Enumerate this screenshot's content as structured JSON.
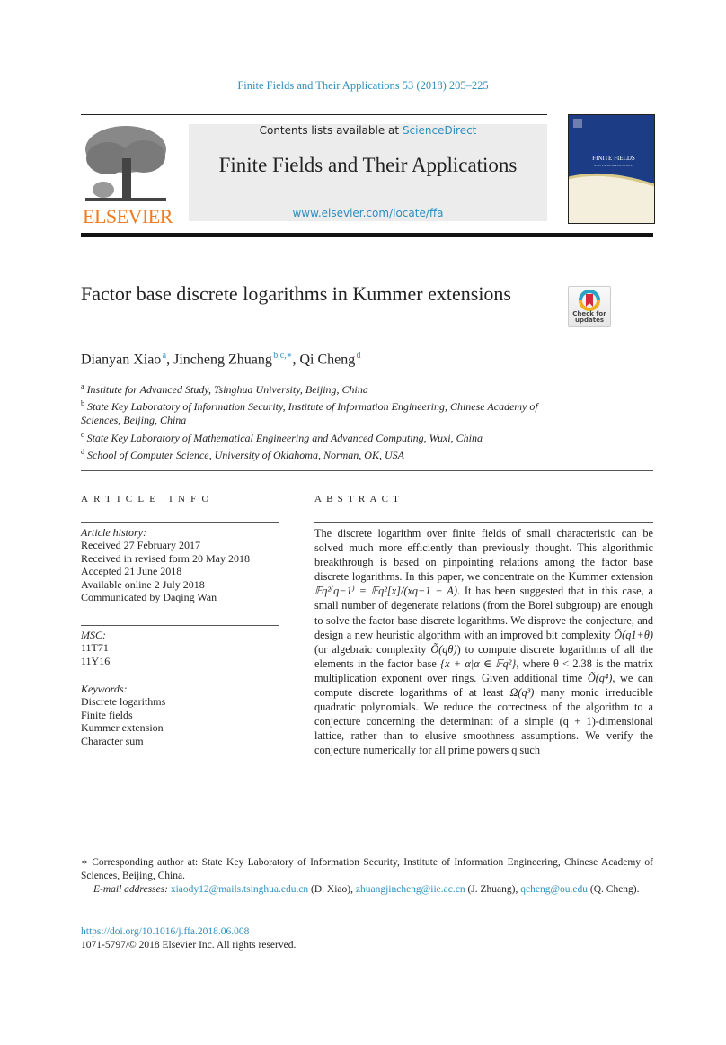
{
  "header": {
    "journal_reference": "Finite Fields and Their Applications 53 (2018) 205–225",
    "contents_prefix": "Contents lists available at ",
    "contents_link": "ScienceDirect",
    "journal_title": "Finite Fields and Their Applications",
    "journal_url": "www.elsevier.com/locate/ffa",
    "publisher_logo_text": "ELSEVIER",
    "cover_title": "FINITE FIELDS",
    "cover_subtitle": "AND THEIR APPLICATIONS"
  },
  "article": {
    "title": "Factor base discrete logarithms in Kummer extensions",
    "crossmark_label": "Check for updates",
    "authors": [
      {
        "name": "Dianyan Xiao",
        "marks": "a"
      },
      {
        "name": "Jincheng Zhuang",
        "marks": "b,c,∗"
      },
      {
        "name": "Qi Cheng",
        "marks": "d"
      }
    ],
    "affiliations": [
      {
        "mark": "a",
        "text": "Institute for Advanced Study, Tsinghua University, Beijing, China"
      },
      {
        "mark": "b",
        "text": "State Key Laboratory of Information Security, Institute of Information Engineering, Chinese Academy of Sciences, Beijing, China"
      },
      {
        "mark": "c",
        "text": "State Key Laboratory of Mathematical Engineering and Advanced Computing, Wuxi, China"
      },
      {
        "mark": "d",
        "text": "School of Computer Science, University of Oklahoma, Norman, OK, USA"
      }
    ]
  },
  "article_info": {
    "heading": "ARTICLE INFO",
    "history_label": "Article history:",
    "history": [
      "Received 27 February 2017",
      "Received in revised form 20 May 2018",
      "Accepted 21 June 2018",
      "Available online 2 July 2018",
      "Communicated by Daqing Wan"
    ],
    "msc_label": "MSC:",
    "msc": [
      "11T71",
      "11Y16"
    ],
    "keywords_label": "Keywords:",
    "keywords": [
      "Discrete logarithms",
      "Finite fields",
      "Kummer extension",
      "Character sum"
    ]
  },
  "abstract": {
    "heading": "ABSTRACT",
    "p1": "The discrete logarithm over finite fields of small characteristic can be solved much more efficiently than previously thought. This algorithmic breakthrough is based on pinpointing relations among the factor base discrete logarithms. In this paper, we concentrate on the Kummer extension ",
    "m1": "𝔽q²⁽q−1⁾ = 𝔽q²[x]/(xq−1 − A)",
    "p2": ". It has been suggested that in this case, a small number of degenerate relations (from the Borel subgroup) are enough to solve the factor base discrete logarithms. We disprove the conjecture, and design a new heuristic algorithm with an improved bit complexity ",
    "m2": "Õ(q1+θ)",
    "p3": " (or algebraic complexity ",
    "m3": "Õ(qθ)",
    "p4": ") to compute discrete logarithms of all the elements in the factor base ",
    "m4": "{x + α|α ∈ 𝔽q²}",
    "p5": ", where θ < 2.38 is the matrix multiplication exponent over rings. Given additional time ",
    "m5": "Õ(q⁴)",
    "p6": ", we can compute discrete logarithms of at least ",
    "m6": "Ω(q³)",
    "p7": " many monic irreducible quadratic polynomials. We reduce the correctness of the algorithm to a conjecture concerning the determinant of a simple (q + 1)-dimensional lattice, rather than to elusive smoothness assumptions. We verify the conjecture numerically for all prime powers q such"
  },
  "footnote": {
    "star_text": "∗ Corresponding author at: State Key Laboratory of Information Security, Institute of Information Engineering, Chinese Academy of Sciences, Beijing, China.",
    "email_label": "E-mail addresses:",
    "emails": [
      {
        "address": "xiaody12@mails.tsinghua.edu.cn",
        "who": "(D. Xiao)"
      },
      {
        "address": "zhuangjincheng@iie.ac.cn",
        "who": "(J. Zhuang)"
      },
      {
        "address": "qcheng@ou.edu",
        "who": "(Q. Cheng)."
      }
    ],
    "doi": "https://doi.org/10.1016/j.ffa.2018.06.008",
    "copyright": "1071-5797/© 2018 Elsevier Inc. All rights reserved."
  },
  "colors": {
    "link": "#2e8fbf",
    "elsevier_orange": "#f07b20",
    "cover_blue": "#1c3d86",
    "masthead_gray": "#ececec"
  }
}
